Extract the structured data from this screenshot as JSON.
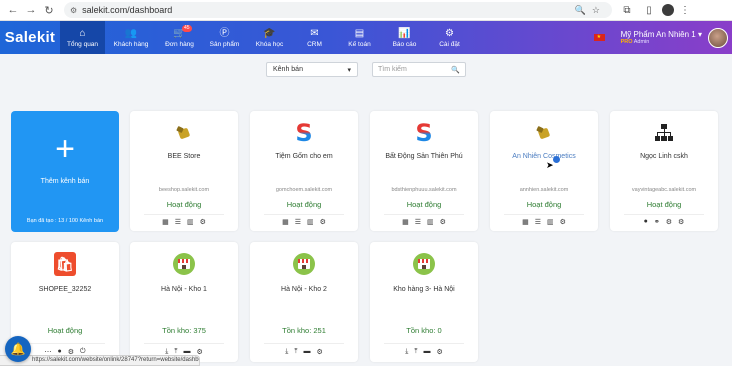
{
  "browser": {
    "url": "salekit.com/dashboard"
  },
  "brand": {
    "logo": "Salekit",
    "accent": "#2196f3",
    "nav_start": "#1e66d8",
    "nav_end": "#8a3ec9"
  },
  "nav": {
    "items": [
      {
        "label": "Tổng quan",
        "icon": "home-icon",
        "glyph": "⌂",
        "active": true
      },
      {
        "label": "Khách hàng",
        "icon": "users-icon",
        "glyph": "👥"
      },
      {
        "label": "Đơn hàng",
        "icon": "orders-icon",
        "glyph": "🛒",
        "badge": "45"
      },
      {
        "label": "Sản phẩm",
        "icon": "product-icon",
        "glyph": "Ⓟ"
      },
      {
        "label": "Khóa học",
        "icon": "course-icon",
        "glyph": "🎓"
      },
      {
        "label": "CRM",
        "icon": "crm-icon",
        "glyph": "✉"
      },
      {
        "label": "Kế toán",
        "icon": "accounting-icon",
        "glyph": "▤"
      },
      {
        "label": "Báo cáo",
        "icon": "report-icon",
        "glyph": "📊"
      },
      {
        "label": "Cài đặt",
        "icon": "settings-icon",
        "glyph": "⚙"
      }
    ],
    "user_name": "Mỹ Phẩm An Nhiên 1",
    "user_badge": "PRO",
    "user_role": "Admin"
  },
  "filters": {
    "channel_select": "Kênh bán",
    "search_placeholder": "Tìm kiếm"
  },
  "add_card": {
    "label": "Thêm kênh bán",
    "used": "Bạn đã tạo : 13 / 100 Kênh bán"
  },
  "stores_row1": [
    {
      "name": "BEE Store",
      "domain": "beeshop.salekit.com",
      "status": "Hoạt động",
      "logo": "bee-logo",
      "actions": [
        "▦",
        "☰",
        "▥",
        "⚙"
      ]
    },
    {
      "name": "Tiệm Gốm cho em",
      "domain": "gomchoem.salekit.com",
      "status": "Hoạt động",
      "logo": "s-logo",
      "actions": [
        "▦",
        "☰",
        "▥",
        "⚙"
      ]
    },
    {
      "name": "Bất Động Sản Thiên Phú",
      "domain": "bdsthienphuuu.salekit.com",
      "status": "Hoạt động",
      "logo": "s-logo",
      "actions": [
        "▦",
        "☰",
        "▥",
        "⚙"
      ]
    },
    {
      "name": "An Nhiên Cosmetics",
      "domain": "annhien.salekit.com",
      "status": "Hoạt động",
      "logo": "bee-logo",
      "actions": [
        "▦",
        "☰",
        "▥",
        "⚙"
      ]
    },
    {
      "name": "Ngọc Linh cskh",
      "domain": "vayvintageabc.salekit.com",
      "status": "Hoạt động",
      "logo": "hierarchy-logo",
      "actions": [
        "●",
        "⚭",
        "⚙",
        "⚙"
      ]
    }
  ],
  "stores_row2": [
    {
      "name": "SHOPEE_32252",
      "status": "Hoạt động",
      "logo": "shopee-logo",
      "actions": [
        "⋯",
        "●",
        "⚙",
        "⏻"
      ]
    },
    {
      "name": "Hà Nội - Kho 1",
      "status": "Tồn kho: 375",
      "logo": "kiosk-logo",
      "actions": [
        "⤓",
        "⤒",
        "▬",
        "⚙"
      ]
    },
    {
      "name": "Hà Nội - Kho 2",
      "status": "Tồn kho: 251",
      "logo": "kiosk-logo",
      "actions": [
        "⤓",
        "⤒",
        "▬",
        "⚙"
      ]
    },
    {
      "name": "Kho hàng 3- Hà Nội",
      "status": "Tồn kho: 0",
      "logo": "kiosk-logo",
      "actions": [
        "⤓",
        "⤒",
        "▬",
        "⚙"
      ]
    }
  ],
  "status_bar": "https://salekit.com/website/onlink/28747?return=website/dashboard"
}
